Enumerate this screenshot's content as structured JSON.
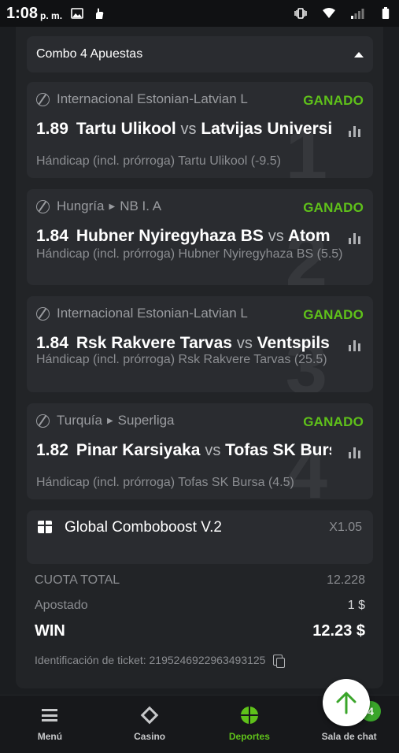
{
  "statusbar": {
    "time": "1:08",
    "ampm": "p. m."
  },
  "combo": {
    "title": "Combo 4 Apuestas"
  },
  "bets": [
    {
      "index": "1",
      "league": "Internacional Estonian-Latvian L",
      "status": "GANADO",
      "odd": "1.89",
      "home": "Tartu Ulikool",
      "vs": "vs",
      "away": "Latvijas Universit",
      "market": "Hándicap (incl. prórroga) Tartu Ulikool (-9.5)"
    },
    {
      "index": "2",
      "country": "Hungría",
      "league": "NB I. A",
      "status": "GANADO",
      "odd": "1.84",
      "home": "Hubner Nyiregyhaza BS",
      "vs": "vs",
      "away": "Atom",
      "market": "Hándicap (incl. prórroga) Hubner Nyiregyhaza BS (5.5)"
    },
    {
      "index": "3",
      "league": "Internacional Estonian-Latvian L",
      "status": "GANADO",
      "odd": "1.84",
      "home": "Rsk Rakvere Tarvas",
      "vs": "vs",
      "away": "Ventspils",
      "market": "Hándicap (incl. prórroga) Rsk Rakvere Tarvas (25.5)"
    },
    {
      "index": "4",
      "country": "Turquía",
      "league": "Superliga",
      "status": "GANADO",
      "odd": "1.82",
      "home": "Pinar Karsiyaka",
      "vs": "vs",
      "away": "Tofas SK Bursa",
      "market": "Hándicap (incl. prórroga) Tofas SK Bursa (4.5)"
    }
  ],
  "boost": {
    "name": "Global Comboboost V.2",
    "multiplier": "X1.05"
  },
  "summary": {
    "total_label": "CUOTA TOTAL",
    "total_value": "12.228",
    "staked_label": "Apostado",
    "staked_value": "1 $",
    "win_label": "WIN",
    "win_value": "12.23 $"
  },
  "ticket": {
    "label": "Identificación de ticket: 2195246922963493125"
  },
  "nav": {
    "menu": "Menú",
    "casino": "Casino",
    "sports": "Deportes",
    "chat": "Sala de chat",
    "chat_badge": "4"
  },
  "colors": {
    "accent": "#5fc11a",
    "background": "#1b1d20",
    "card": "#2a2c30"
  }
}
